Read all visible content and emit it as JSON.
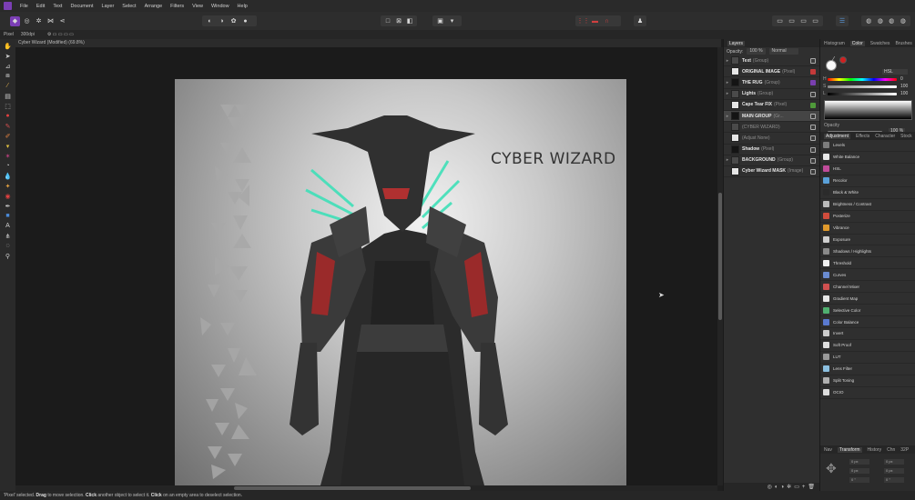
{
  "menu": [
    "File",
    "Edit",
    "Text",
    "Document",
    "Layer",
    "Select",
    "Arrange",
    "Filters",
    "View",
    "Window",
    "Help"
  ],
  "context_bar": {
    "persona": "Pixel",
    "dpi": "300dpi"
  },
  "document_tab": "Cyber Wizard (Modified) (69.8%)",
  "artboard": {
    "title_text": "CYBER WIZARD"
  },
  "status": {
    "text_pre": "'Pixel' selected. ",
    "drag": "Drag",
    "mid1": " to move selection. ",
    "click1": "Click",
    "mid2": " another object to select it. ",
    "click2": "Click",
    "end": " on an empty area to deselect selection."
  },
  "layers_panel": {
    "tabs": [
      "Layers"
    ],
    "opacity_label": "Opacity:",
    "opacity_value": "100 %",
    "blend_mode": "Normal",
    "layers": [
      {
        "name": "Text",
        "kind": "(Group)",
        "vis": "default"
      },
      {
        "name": "ORIGINAL IMAGE",
        "kind": "(Pixel)",
        "vis": "red"
      },
      {
        "name": "THE RUG",
        "kind": "(Group)",
        "vis": "purple"
      },
      {
        "name": "Lights",
        "kind": "(Group)",
        "vis": "default"
      },
      {
        "name": "Cape Tear FIX",
        "kind": "(Pixel)",
        "vis": "green"
      },
      {
        "name": "MAIN GROUP",
        "kind": "(Gr...",
        "vis": "default"
      },
      {
        "name": "(CYBER WIZARD)",
        "kind": "",
        "vis": "default",
        "dim": true
      },
      {
        "name": "(Adjust None)",
        "kind": "",
        "vis": "default",
        "dim": true
      },
      {
        "name": "Shadow",
        "kind": "(Pixel)",
        "vis": "default"
      },
      {
        "name": "BACKGROUND",
        "kind": "(Group)",
        "vis": "default"
      },
      {
        "name": "Cyber Wizard MASK",
        "kind": "(Image)",
        "vis": "default"
      }
    ]
  },
  "right_panel": {
    "tabs": [
      "Histogram",
      "Color",
      "Swatches",
      "Brushes"
    ],
    "color_model": "HSL",
    "sliders": [
      {
        "label": "H",
        "value": "0"
      },
      {
        "label": "S",
        "value": "100"
      },
      {
        "label": "L",
        "value": "100"
      }
    ],
    "opacity_label": "Opacity",
    "opacity_value": "100 %",
    "adjustment_tabs": [
      "Adjustment",
      "Effects",
      "Character",
      "Stock"
    ],
    "adjustments": [
      {
        "label": "Levels",
        "color": "#7d7d7d"
      },
      {
        "label": "White Balance",
        "color": "#e8e8e8"
      },
      {
        "label": "HSL",
        "color": "#c04b9a"
      },
      {
        "label": "Recolor",
        "color": "#5aa0d8"
      },
      {
        "label": "Black & White",
        "color": "#2b2b2b"
      },
      {
        "label": "Brightness / Contrast",
        "color": "#bbbbbb"
      },
      {
        "label": "Posterize",
        "color": "#d04c3c"
      },
      {
        "label": "Vibrance",
        "color": "#e09a2c"
      },
      {
        "label": "Exposure",
        "color": "#cfcfcf"
      },
      {
        "label": "Shadows / Highlights",
        "color": "#8a8a8a"
      },
      {
        "label": "Threshold",
        "color": "#f0f0f0"
      },
      {
        "label": "Curves",
        "color": "#6a8bd0"
      },
      {
        "label": "Channel Mixer",
        "color": "#d05050"
      },
      {
        "label": "Gradient Map",
        "color": "#e8e8e8"
      },
      {
        "label": "Selective Color",
        "color": "#50b070"
      },
      {
        "label": "Color Balance",
        "color": "#5a7ad0"
      },
      {
        "label": "Invert",
        "color": "#cccccc"
      },
      {
        "label": "Soft Proof",
        "color": "#e0e0e0"
      },
      {
        "label": "LUT",
        "color": "#999999"
      },
      {
        "label": "Lens Filter",
        "color": "#8cc0e0"
      },
      {
        "label": "Split Toning",
        "color": "#b0b0b0"
      },
      {
        "label": "OCIO",
        "color": "#dddddd"
      }
    ],
    "nav_tabs": [
      "Nav",
      "Transform",
      "History",
      "Chn",
      "32P"
    ],
    "transform_fields": [
      "0 px",
      "0 px",
      "0 px",
      "0 px",
      "0 °",
      "0 °"
    ]
  }
}
